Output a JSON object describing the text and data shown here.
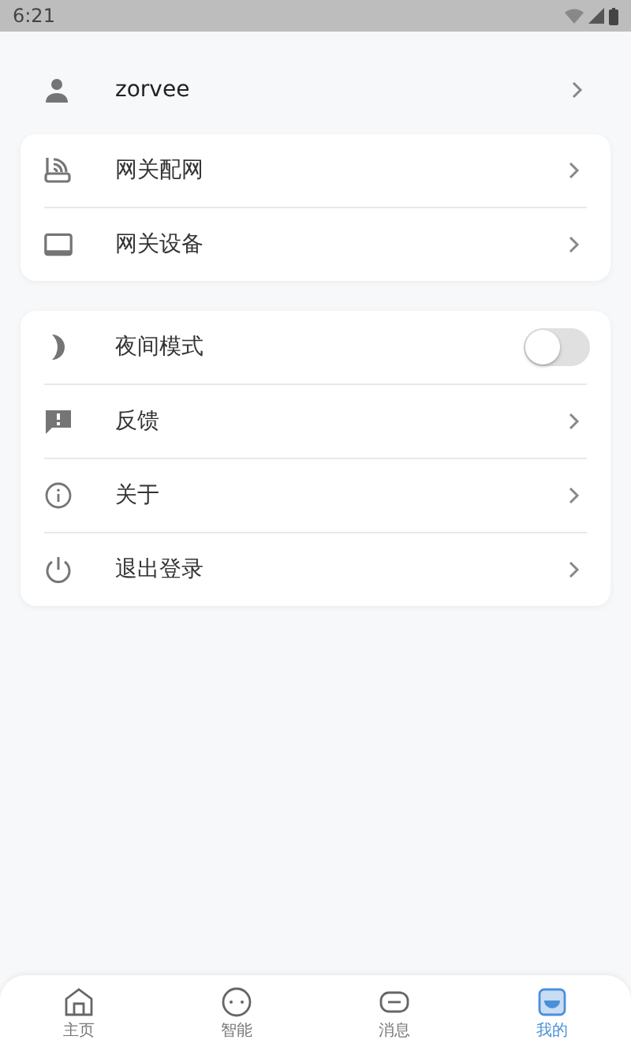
{
  "status_bar": {
    "time": "6:21"
  },
  "profile": {
    "name": "zorvee"
  },
  "groups": [
    {
      "items": [
        {
          "kind": "link",
          "label": "网关配网"
        },
        {
          "kind": "link",
          "label": "网关设备"
        }
      ]
    },
    {
      "items": [
        {
          "kind": "toggle",
          "label": "夜间模式",
          "on": false
        },
        {
          "kind": "link",
          "label": "反馈"
        },
        {
          "kind": "link",
          "label": "关于"
        },
        {
          "kind": "link",
          "label": "退出登录"
        }
      ]
    }
  ],
  "tabs": [
    {
      "label": "主页",
      "selected": false
    },
    {
      "label": "智能",
      "selected": false
    },
    {
      "label": "消息",
      "selected": false
    },
    {
      "label": "我的",
      "selected": true
    }
  ]
}
